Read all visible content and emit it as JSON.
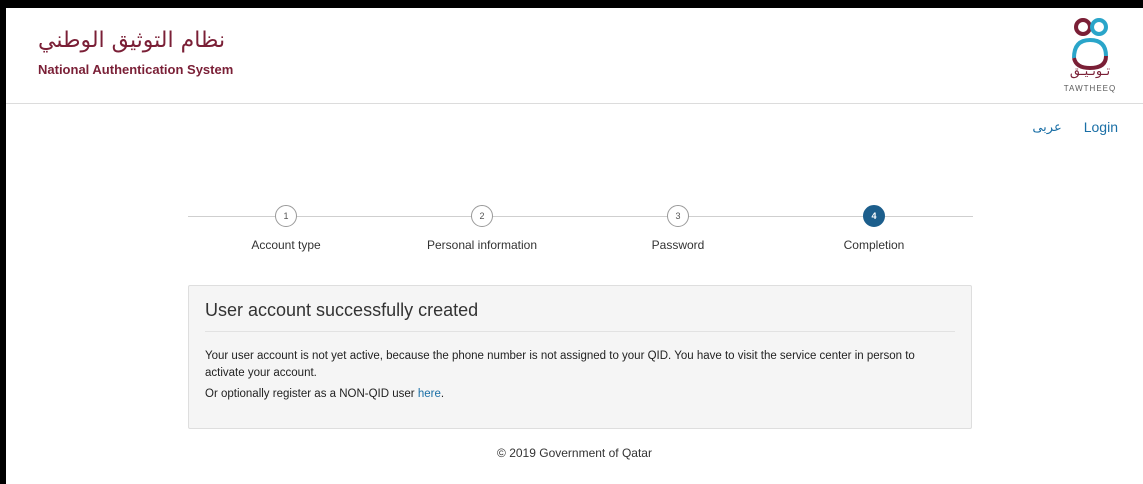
{
  "header": {
    "title_ar": "نظام التوثيق الوطني",
    "title_en": "National Authentication System",
    "logo_ar": "تـوثـيـق",
    "logo_en": "TAWTHEEQ"
  },
  "nav": {
    "lang_label": "عربى",
    "login_label": "Login"
  },
  "steps": [
    {
      "number": "1",
      "label": "Account type",
      "active": false
    },
    {
      "number": "2",
      "label": "Personal information",
      "active": false
    },
    {
      "number": "3",
      "label": "Password",
      "active": false
    },
    {
      "number": "4",
      "label": "Completion",
      "active": true
    }
  ],
  "panel": {
    "heading": "User account successfully created",
    "message": "Your user account is not yet active, because the phone number is not assigned to your QID. You have to visit the service center in person to activate your account.",
    "alt_prefix": "Or optionally register as a NON-QID user ",
    "alt_link": "here",
    "alt_suffix": "."
  },
  "footer": {
    "copyright": "© 2019 Government of Qatar"
  },
  "colors": {
    "brand": "#7a1f36",
    "accent": "#1c5e8c",
    "link": "#1a6fa6"
  }
}
